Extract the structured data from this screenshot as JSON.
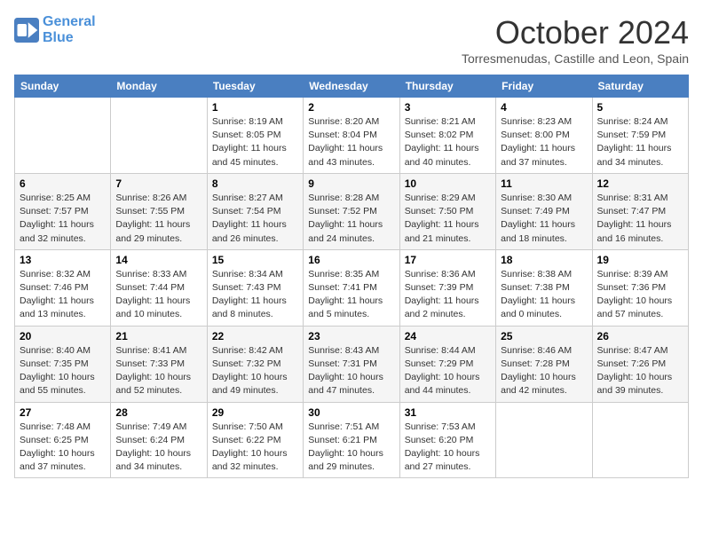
{
  "header": {
    "logo_line1": "General",
    "logo_line2": "Blue",
    "month": "October 2024",
    "location": "Torresmenudas, Castille and Leon, Spain"
  },
  "days_of_week": [
    "Sunday",
    "Monday",
    "Tuesday",
    "Wednesday",
    "Thursday",
    "Friday",
    "Saturday"
  ],
  "weeks": [
    [
      {
        "day": "",
        "info": ""
      },
      {
        "day": "",
        "info": ""
      },
      {
        "day": "1",
        "info": "Sunrise: 8:19 AM\nSunset: 8:05 PM\nDaylight: 11 hours and 45 minutes."
      },
      {
        "day": "2",
        "info": "Sunrise: 8:20 AM\nSunset: 8:04 PM\nDaylight: 11 hours and 43 minutes."
      },
      {
        "day": "3",
        "info": "Sunrise: 8:21 AM\nSunset: 8:02 PM\nDaylight: 11 hours and 40 minutes."
      },
      {
        "day": "4",
        "info": "Sunrise: 8:23 AM\nSunset: 8:00 PM\nDaylight: 11 hours and 37 minutes."
      },
      {
        "day": "5",
        "info": "Sunrise: 8:24 AM\nSunset: 7:59 PM\nDaylight: 11 hours and 34 minutes."
      }
    ],
    [
      {
        "day": "6",
        "info": "Sunrise: 8:25 AM\nSunset: 7:57 PM\nDaylight: 11 hours and 32 minutes."
      },
      {
        "day": "7",
        "info": "Sunrise: 8:26 AM\nSunset: 7:55 PM\nDaylight: 11 hours and 29 minutes."
      },
      {
        "day": "8",
        "info": "Sunrise: 8:27 AM\nSunset: 7:54 PM\nDaylight: 11 hours and 26 minutes."
      },
      {
        "day": "9",
        "info": "Sunrise: 8:28 AM\nSunset: 7:52 PM\nDaylight: 11 hours and 24 minutes."
      },
      {
        "day": "10",
        "info": "Sunrise: 8:29 AM\nSunset: 7:50 PM\nDaylight: 11 hours and 21 minutes."
      },
      {
        "day": "11",
        "info": "Sunrise: 8:30 AM\nSunset: 7:49 PM\nDaylight: 11 hours and 18 minutes."
      },
      {
        "day": "12",
        "info": "Sunrise: 8:31 AM\nSunset: 7:47 PM\nDaylight: 11 hours and 16 minutes."
      }
    ],
    [
      {
        "day": "13",
        "info": "Sunrise: 8:32 AM\nSunset: 7:46 PM\nDaylight: 11 hours and 13 minutes."
      },
      {
        "day": "14",
        "info": "Sunrise: 8:33 AM\nSunset: 7:44 PM\nDaylight: 11 hours and 10 minutes."
      },
      {
        "day": "15",
        "info": "Sunrise: 8:34 AM\nSunset: 7:43 PM\nDaylight: 11 hours and 8 minutes."
      },
      {
        "day": "16",
        "info": "Sunrise: 8:35 AM\nSunset: 7:41 PM\nDaylight: 11 hours and 5 minutes."
      },
      {
        "day": "17",
        "info": "Sunrise: 8:36 AM\nSunset: 7:39 PM\nDaylight: 11 hours and 2 minutes."
      },
      {
        "day": "18",
        "info": "Sunrise: 8:38 AM\nSunset: 7:38 PM\nDaylight: 11 hours and 0 minutes."
      },
      {
        "day": "19",
        "info": "Sunrise: 8:39 AM\nSunset: 7:36 PM\nDaylight: 10 hours and 57 minutes."
      }
    ],
    [
      {
        "day": "20",
        "info": "Sunrise: 8:40 AM\nSunset: 7:35 PM\nDaylight: 10 hours and 55 minutes."
      },
      {
        "day": "21",
        "info": "Sunrise: 8:41 AM\nSunset: 7:33 PM\nDaylight: 10 hours and 52 minutes."
      },
      {
        "day": "22",
        "info": "Sunrise: 8:42 AM\nSunset: 7:32 PM\nDaylight: 10 hours and 49 minutes."
      },
      {
        "day": "23",
        "info": "Sunrise: 8:43 AM\nSunset: 7:31 PM\nDaylight: 10 hours and 47 minutes."
      },
      {
        "day": "24",
        "info": "Sunrise: 8:44 AM\nSunset: 7:29 PM\nDaylight: 10 hours and 44 minutes."
      },
      {
        "day": "25",
        "info": "Sunrise: 8:46 AM\nSunset: 7:28 PM\nDaylight: 10 hours and 42 minutes."
      },
      {
        "day": "26",
        "info": "Sunrise: 8:47 AM\nSunset: 7:26 PM\nDaylight: 10 hours and 39 minutes."
      }
    ],
    [
      {
        "day": "27",
        "info": "Sunrise: 7:48 AM\nSunset: 6:25 PM\nDaylight: 10 hours and 37 minutes."
      },
      {
        "day": "28",
        "info": "Sunrise: 7:49 AM\nSunset: 6:24 PM\nDaylight: 10 hours and 34 minutes."
      },
      {
        "day": "29",
        "info": "Sunrise: 7:50 AM\nSunset: 6:22 PM\nDaylight: 10 hours and 32 minutes."
      },
      {
        "day": "30",
        "info": "Sunrise: 7:51 AM\nSunset: 6:21 PM\nDaylight: 10 hours and 29 minutes."
      },
      {
        "day": "31",
        "info": "Sunrise: 7:53 AM\nSunset: 6:20 PM\nDaylight: 10 hours and 27 minutes."
      },
      {
        "day": "",
        "info": ""
      },
      {
        "day": "",
        "info": ""
      }
    ]
  ]
}
